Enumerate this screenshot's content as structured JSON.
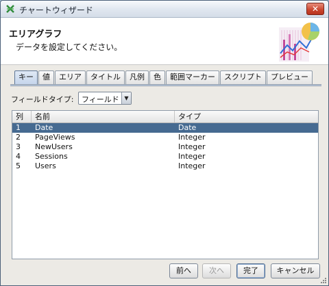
{
  "window": {
    "title": "チャートウィザード",
    "close_label": "✕"
  },
  "header": {
    "title": "エリアグラフ",
    "subtitle": "データを設定してください。"
  },
  "tabs": [
    {
      "label": "キー",
      "active": true
    },
    {
      "label": "値",
      "active": false
    },
    {
      "label": "エリア",
      "active": false
    },
    {
      "label": "タイトル",
      "active": false
    },
    {
      "label": "凡例",
      "active": false
    },
    {
      "label": "色",
      "active": false
    },
    {
      "label": "範囲マーカー",
      "active": false
    },
    {
      "label": "スクリプト",
      "active": false
    },
    {
      "label": "プレビュー",
      "active": false
    }
  ],
  "field_type": {
    "label": "フィールドタイプ:",
    "value": "フィールド"
  },
  "table": {
    "columns": [
      "列",
      "名前",
      "タイプ"
    ],
    "rows": [
      {
        "col": "1",
        "name": "Date",
        "type": "Date",
        "selected": true
      },
      {
        "col": "2",
        "name": "PageViews",
        "type": "Integer",
        "selected": false
      },
      {
        "col": "3",
        "name": "NewUsers",
        "type": "Integer",
        "selected": false
      },
      {
        "col": "4",
        "name": "Sessions",
        "type": "Integer",
        "selected": false
      },
      {
        "col": "5",
        "name": "Users",
        "type": "Integer",
        "selected": false
      }
    ]
  },
  "buttons": {
    "prev": "前へ",
    "next": "次へ",
    "finish": "完了",
    "cancel": "キャンセル"
  },
  "colors": {
    "selection": "#466a91",
    "tab_active": "#c6d6ec"
  }
}
